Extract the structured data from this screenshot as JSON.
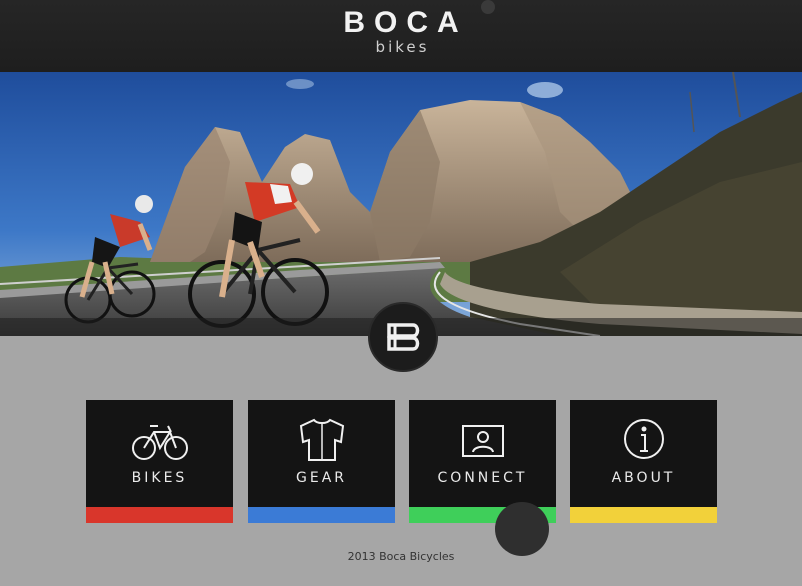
{
  "header": {
    "brand": "BOCA",
    "subtitle": "bikes"
  },
  "hero": {
    "image_description_icon": "cyclists-mountain-photo"
  },
  "logo": {
    "icon": "boca-bb-logo-icon"
  },
  "tiles": [
    {
      "label": "BIKES",
      "icon": "bicycle-icon",
      "color": "#d9362b"
    },
    {
      "label": "GEAR",
      "icon": "jersey-icon",
      "color": "#3b7bd6"
    },
    {
      "label": "CONNECT",
      "icon": "contact-card-icon",
      "color": "#3fcf5a"
    },
    {
      "label": "ABOUT",
      "icon": "info-icon",
      "color": "#f2d13a"
    }
  ],
  "footer": {
    "text": "2013 Boca Bicycles"
  }
}
